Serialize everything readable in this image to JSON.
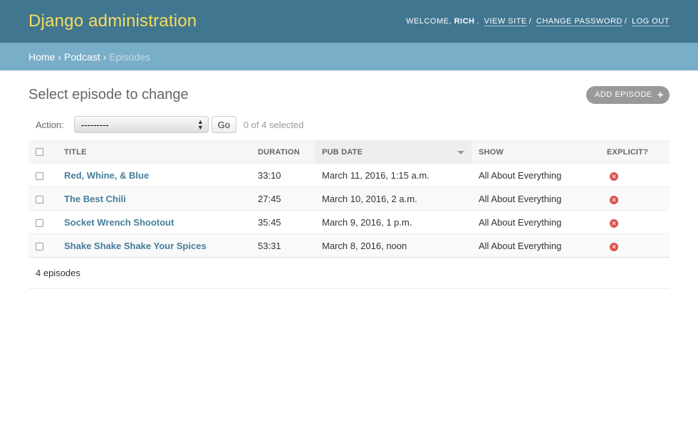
{
  "header": {
    "brand": "Django administration",
    "welcome": "Welcome,",
    "username": "Rich",
    "view_site": "View site",
    "change_password": "Change password",
    "log_out": "Log out",
    "bg_color": "#417690",
    "brand_color": "#f5dd5d"
  },
  "breadcrumbs": {
    "home": "Home",
    "app": "Podcast",
    "current": "Episodes",
    "separator": "›"
  },
  "page": {
    "title": "Select episode to change",
    "add_button": "Add episode"
  },
  "actions": {
    "label": "Action:",
    "selected_option": "---------",
    "go": "Go",
    "selected_count": "0 of 4 selected"
  },
  "table": {
    "columns": [
      "Title",
      "Duration",
      "Pub date",
      "Show",
      "Explicit?"
    ],
    "sorted_column": "Pub date",
    "rows": [
      {
        "title": "Red, Whine, & Blue",
        "duration": "33:10",
        "pub_date": "March 11, 2016, 1:15 a.m.",
        "show": "All About Everything",
        "explicit": "no"
      },
      {
        "title": "The Best Chili",
        "duration": "27:45",
        "pub_date": "March 10, 2016, 2 a.m.",
        "show": "All About Everything",
        "explicit": "no"
      },
      {
        "title": "Socket Wrench Shootout",
        "duration": "35:45",
        "pub_date": "March 9, 2016, 1 p.m.",
        "show": "All About Everything",
        "explicit": "no"
      },
      {
        "title": "Shake Shake Shake Your Spices",
        "duration": "53:31",
        "pub_date": "March 8, 2016, noon",
        "show": "All About Everything",
        "explicit": "no"
      }
    ]
  },
  "paginator": {
    "text": "4 episodes"
  }
}
